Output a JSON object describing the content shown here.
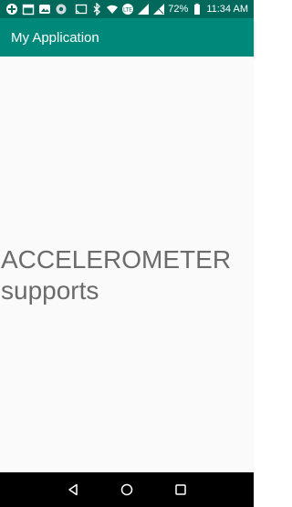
{
  "status_bar": {
    "battery": "72%",
    "time": "11:34 AM",
    "left_icons": [
      "app-notification-icon",
      "calendar-icon",
      "photos-icon",
      "settings-icon"
    ],
    "right_icons": [
      "cast-icon",
      "bluetooth-icon",
      "wifi-icon",
      "volte-icon",
      "signal-icon",
      "signal-icon-2",
      "battery-icon"
    ]
  },
  "app_bar": {
    "title": "My Application",
    "color": "#00897b",
    "status_color": "#00695c"
  },
  "content": {
    "sensor_text": "ACCELEROMETER\nsupports"
  },
  "nav_bar": {
    "buttons": [
      "back-icon",
      "home-icon",
      "recents-icon"
    ]
  }
}
